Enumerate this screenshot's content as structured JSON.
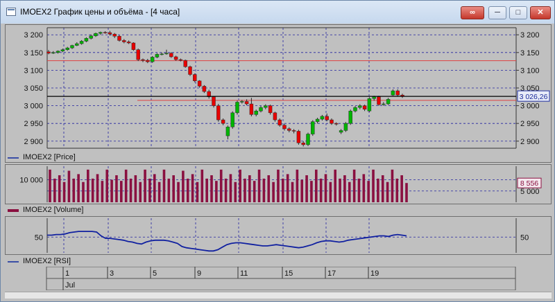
{
  "window": {
    "title": "IMOEX2 График цены и объёма - [4 часа]"
  },
  "controls": {
    "pin_icon": "link-icon",
    "minimize_icon": "minimize-icon",
    "maximize_icon": "maximize-icon",
    "close_icon": "close-icon"
  },
  "price_pane": {
    "legend": "IMOEX2 [Price]",
    "y_ticks": [
      "3 200",
      "3 150",
      "3 100",
      "3 050",
      "3 000",
      "2 950",
      "2 900"
    ],
    "y_tick_values": [
      3200,
      3150,
      3100,
      3050,
      3000,
      2950,
      2900
    ],
    "current_price_label": "3 026,26",
    "current_price": 3026.26,
    "level_lines": [
      3127,
      3015
    ],
    "colors": {
      "up": "#00b400",
      "down": "#e60000",
      "current_line": "#000000",
      "level_line": "#e04040",
      "grid": "#2020a0"
    }
  },
  "volume_pane": {
    "legend": "IMOEX2 [Volume]",
    "y_ticks": [
      "10 000",
      "5 000"
    ],
    "right_label": "8 556",
    "colors": {
      "bar": "#8a1040"
    }
  },
  "rsi_pane": {
    "legend": "IMOEX2 [RSI]",
    "y_tick": "50",
    "colors": {
      "line": "#1020a0"
    }
  },
  "time_axis": {
    "day_labels": [
      "1",
      "3",
      "5",
      "9",
      "11",
      "15",
      "17",
      "19"
    ],
    "month_label": "Jul"
  },
  "chart_data": [
    {
      "type": "candlestick",
      "ylim": [
        2880,
        3220
      ],
      "y_ticks": [
        3200,
        3150,
        3100,
        3050,
        3000,
        2950,
        2900
      ],
      "grid": true,
      "candles": [
        {
          "o": 3152,
          "c": 3148,
          "h": 3157,
          "l": 3145
        },
        {
          "o": 3148,
          "c": 3150,
          "h": 3154,
          "l": 3146
        },
        {
          "o": 3150,
          "c": 3154,
          "h": 3156,
          "l": 3147
        },
        {
          "o": 3154,
          "c": 3158,
          "h": 3161,
          "l": 3151
        },
        {
          "o": 3158,
          "c": 3163,
          "h": 3166,
          "l": 3155
        },
        {
          "o": 3163,
          "c": 3170,
          "h": 3172,
          "l": 3160
        },
        {
          "o": 3170,
          "c": 3175,
          "h": 3179,
          "l": 3168
        },
        {
          "o": 3175,
          "c": 3182,
          "h": 3185,
          "l": 3172
        },
        {
          "o": 3182,
          "c": 3190,
          "h": 3193,
          "l": 3179
        },
        {
          "o": 3190,
          "c": 3197,
          "h": 3201,
          "l": 3187
        },
        {
          "o": 3197,
          "c": 3204,
          "h": 3206,
          "l": 3194
        },
        {
          "o": 3204,
          "c": 3207,
          "h": 3209,
          "l": 3200
        },
        {
          "o": 3207,
          "c": 3206,
          "h": 3210,
          "l": 3203
        },
        {
          "o": 3206,
          "c": 3202,
          "h": 3211,
          "l": 3198
        },
        {
          "o": 3202,
          "c": 3196,
          "h": 3205,
          "l": 3191
        },
        {
          "o": 3196,
          "c": 3184,
          "h": 3199,
          "l": 3181
        },
        {
          "o": 3184,
          "c": 3180,
          "h": 3188,
          "l": 3176
        },
        {
          "o": 3180,
          "c": 3177,
          "h": 3184,
          "l": 3174
        },
        {
          "o": 3177,
          "c": 3158,
          "h": 3179,
          "l": 3155
        },
        {
          "o": 3158,
          "c": 3130,
          "h": 3161,
          "l": 3126
        },
        {
          "o": 3130,
          "c": 3128,
          "h": 3133,
          "l": 3123
        },
        {
          "o": 3128,
          "c": 3124,
          "h": 3132,
          "l": 3120
        },
        {
          "o": 3124,
          "c": 3137,
          "h": 3140,
          "l": 3121
        },
        {
          "o": 3137,
          "c": 3145,
          "h": 3148,
          "l": 3134
        },
        {
          "o": 3145,
          "c": 3146,
          "h": 3150,
          "l": 3142
        },
        {
          "o": 3146,
          "c": 3148,
          "h": 3158,
          "l": 3144
        },
        {
          "o": 3148,
          "c": 3138,
          "h": 3151,
          "l": 3135
        },
        {
          "o": 3138,
          "c": 3130,
          "h": 3141,
          "l": 3127
        },
        {
          "o": 3130,
          "c": 3128,
          "h": 3133,
          "l": 3125
        },
        {
          "o": 3128,
          "c": 3110,
          "h": 3130,
          "l": 3107
        },
        {
          "o": 3110,
          "c": 3088,
          "h": 3113,
          "l": 3084
        },
        {
          "o": 3088,
          "c": 3070,
          "h": 3091,
          "l": 3066
        },
        {
          "o": 3070,
          "c": 3055,
          "h": 3072,
          "l": 3051
        },
        {
          "o": 3055,
          "c": 3040,
          "h": 3058,
          "l": 3036
        },
        {
          "o": 3040,
          "c": 3025,
          "h": 3045,
          "l": 3020
        },
        {
          "o": 3025,
          "c": 3000,
          "h": 3027,
          "l": 2995
        },
        {
          "o": 3000,
          "c": 2960,
          "h": 3005,
          "l": 2955
        },
        {
          "o": 2960,
          "c": 2950,
          "h": 2964,
          "l": 2945
        },
        {
          "o": 2915,
          "c": 2940,
          "h": 2944,
          "l": 2905
        },
        {
          "o": 2940,
          "c": 2980,
          "h": 2984,
          "l": 2935
        },
        {
          "o": 2980,
          "c": 3010,
          "h": 3014,
          "l": 2975
        },
        {
          "o": 3010,
          "c": 3012,
          "h": 3016,
          "l": 3006
        },
        {
          "o": 3012,
          "c": 3005,
          "h": 3018,
          "l": 3001
        },
        {
          "o": 3005,
          "c": 2975,
          "h": 3022,
          "l": 2970
        },
        {
          "o": 2975,
          "c": 2985,
          "h": 2989,
          "l": 2970
        },
        {
          "o": 2985,
          "c": 2995,
          "h": 2999,
          "l": 2981
        },
        {
          "o": 2995,
          "c": 3000,
          "h": 3004,
          "l": 2990
        },
        {
          "o": 3000,
          "c": 2980,
          "h": 3003,
          "l": 2975
        },
        {
          "o": 2980,
          "c": 2960,
          "h": 2983,
          "l": 2955
        },
        {
          "o": 2960,
          "c": 2945,
          "h": 2964,
          "l": 2941
        },
        {
          "o": 2945,
          "c": 2935,
          "h": 2949,
          "l": 2930
        },
        {
          "o": 2935,
          "c": 2930,
          "h": 2939,
          "l": 2925
        },
        {
          "o": 2930,
          "c": 2928,
          "h": 2934,
          "l": 2922
        },
        {
          "o": 2928,
          "c": 2895,
          "h": 2932,
          "l": 2890
        },
        {
          "o": 2895,
          "c": 2890,
          "h": 2900,
          "l": 2885
        },
        {
          "o": 2890,
          "c": 2920,
          "h": 2924,
          "l": 2886
        },
        {
          "o": 2920,
          "c": 2955,
          "h": 2959,
          "l": 2915
        },
        {
          "o": 2955,
          "c": 2962,
          "h": 2966,
          "l": 2950
        },
        {
          "o": 2962,
          "c": 2970,
          "h": 2974,
          "l": 2958
        },
        {
          "o": 2970,
          "c": 2960,
          "h": 2978,
          "l": 2956
        },
        {
          "o": 2960,
          "c": 2950,
          "h": 2964,
          "l": 2946
        },
        {
          "o": 2950,
          "c": 2948,
          "h": 2953,
          "l": 2944
        },
        {
          "o": 2925,
          "c": 2930,
          "h": 2934,
          "l": 2920
        },
        {
          "o": 2930,
          "c": 2950,
          "h": 2954,
          "l": 2926
        },
        {
          "o": 2950,
          "c": 2985,
          "h": 2989,
          "l": 2946
        },
        {
          "o": 2985,
          "c": 2995,
          "h": 2999,
          "l": 2981
        },
        {
          "o": 2995,
          "c": 3000,
          "h": 3004,
          "l": 2990
        },
        {
          "o": 3000,
          "c": 2990,
          "h": 3003,
          "l": 2985
        },
        {
          "o": 2985,
          "c": 3020,
          "h": 3024,
          "l": 2982
        },
        {
          "o": 3020,
          "c": 3025,
          "h": 3028,
          "l": 3014
        },
        {
          "o": 3025,
          "c": 3003,
          "h": 3028,
          "l": 3000
        },
        {
          "o": 3003,
          "c": 3005,
          "h": 3010,
          "l": 3000
        },
        {
          "o": 3005,
          "c": 3018,
          "h": 3022,
          "l": 3002
        },
        {
          "o": 3030,
          "c": 3042,
          "h": 3046,
          "l": 3028
        },
        {
          "o": 3042,
          "c": 3030,
          "h": 3046,
          "l": 3027
        },
        {
          "o": 3030,
          "c": 3026,
          "h": 3034,
          "l": 3022
        }
      ]
    },
    {
      "type": "bar",
      "name": "Volume",
      "ylim": [
        0,
        16000
      ],
      "y_ticks": [
        10000,
        5000
      ],
      "values": [
        14500,
        10500,
        12000,
        9000,
        14000,
        10500,
        12500,
        9000,
        14500,
        10500,
        12500,
        9500,
        14500,
        10000,
        12000,
        9500,
        14500,
        10500,
        12000,
        9000,
        14500,
        10500,
        12500,
        9000,
        14500,
        10500,
        12000,
        9000,
        14000,
        10500,
        12500,
        9000,
        14500,
        10500,
        12000,
        9500,
        14500,
        10500,
        12500,
        9000,
        14500,
        10500,
        12000,
        9500,
        14500,
        10500,
        12000,
        9000,
        14500,
        10500,
        12500,
        9000,
        14500,
        10000,
        12000,
        9500,
        14500,
        10500,
        12500,
        9000,
        14500,
        10500,
        12000,
        9000,
        14500,
        10500,
        12500,
        9500,
        14500,
        10500,
        12000,
        9000,
        14500,
        10500,
        12000,
        8556
      ]
    },
    {
      "type": "line",
      "name": "RSI",
      "ylim": [
        25,
        80
      ],
      "y_ticks": [
        50
      ],
      "values": [
        53,
        53,
        54,
        54,
        55,
        57,
        58,
        59,
        59,
        59,
        59,
        58,
        52,
        48,
        48,
        47,
        46,
        45,
        43,
        42,
        40,
        39,
        42,
        44,
        45,
        45,
        45,
        44,
        42,
        40,
        35,
        33,
        32,
        31,
        30,
        29,
        28,
        28,
        30,
        34,
        38,
        40,
        41,
        41,
        40,
        39,
        38,
        37,
        36,
        36,
        37,
        38,
        37,
        36,
        35,
        34,
        33,
        34,
        36,
        38,
        41,
        43,
        44,
        44,
        43,
        42,
        43,
        45,
        46,
        47,
        48,
        49,
        50,
        51,
        52,
        52,
        51,
        53,
        54,
        53,
        52
      ]
    }
  ]
}
